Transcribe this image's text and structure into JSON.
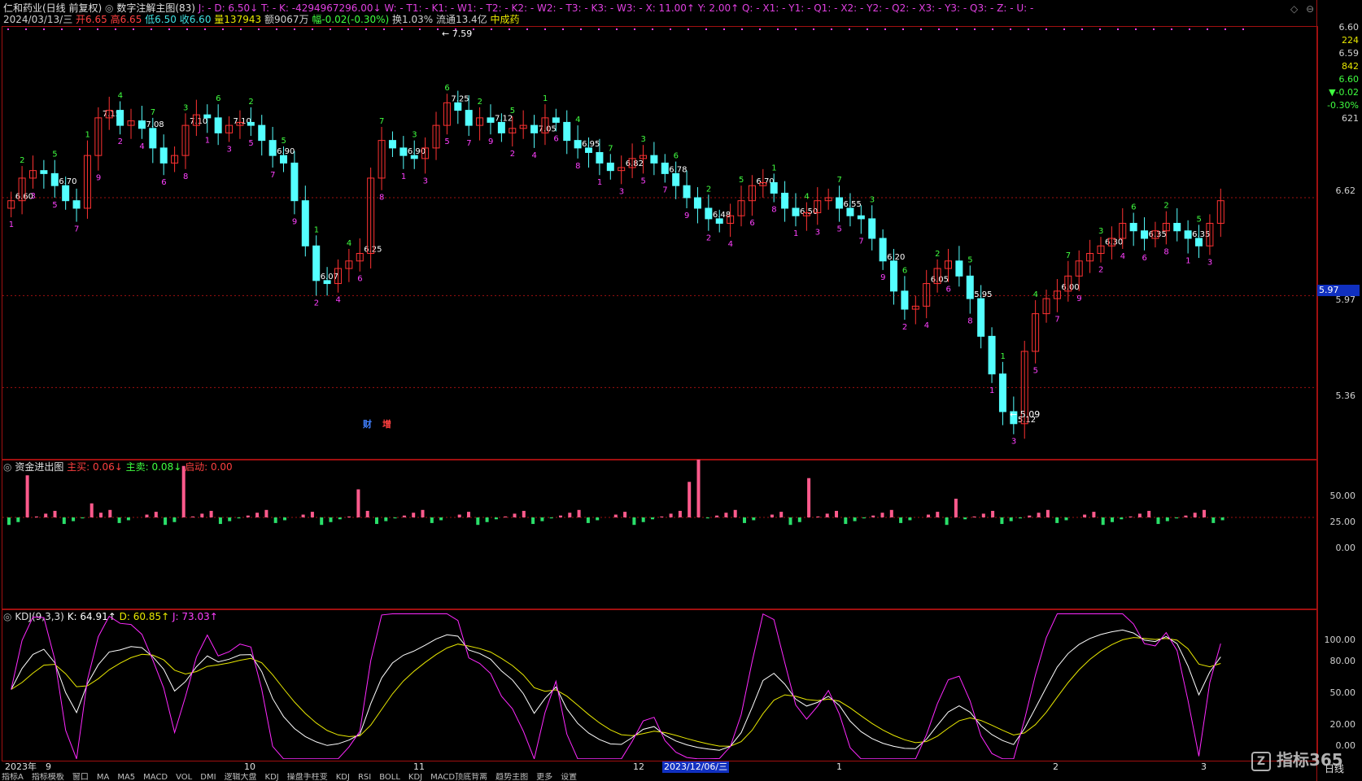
{
  "header": {
    "stock": "仁和药业(日线 前复权)",
    "indicator": "数字注解主图(83)",
    "ind_values": "J: - D: 6.50↓ T: - K: -4294967296.00↓ W: - T1: - K1: - W1: - T2: - K2: - W2: - T3: - K3: - W3: - X: 11.00↑ Y: 2.00↑ Q: - X1: - Y1: - Q1: - X2: - Y2: - Q2: - X3: - Y3: - Q3: - Z: - U: -",
    "date": "2024/03/13/三",
    "open": "开6.65",
    "high": "高6.65",
    "low": "低6.50",
    "close": "收6.60",
    "volume": "量137943",
    "amount": "额9067万",
    "change": "幅-0.02(-0.30%)",
    "turnover": "换1.03%",
    "float": "流通13.4亿",
    "sector": "中成药"
  },
  "right_info": {
    "price1": "6.60",
    "vol1": "224",
    "price2": "6.59",
    "vol2": "842",
    "last": "6.60",
    "chg": "▼-0.02",
    "pct": "-0.30%",
    "amt": "621"
  },
  "price_axis": [
    "6.62",
    "5.97",
    "5.36"
  ],
  "current_price_tag": "5.97",
  "main_marks": [
    "财",
    "增"
  ],
  "max_label": "7.59",
  "min_label": "5.09",
  "fund_panel": {
    "title": "资金进出图",
    "buy_label": "主买: 0.06↓",
    "sell_label": "主卖: 0.08↓",
    "start_label": "启动: 0.00",
    "axis": [
      "50.00",
      "25.00",
      "0.00"
    ]
  },
  "kdj_panel": {
    "title": "KDJ(9,3,3)",
    "k_label": "K: 64.91↑",
    "d_label": "D: 60.85↑",
    "j_label": "J: 73.03↑",
    "axis": [
      "100.00",
      "80.00",
      "50.00",
      "20.00",
      "0.00"
    ]
  },
  "date_axis": {
    "items": [
      "2023年",
      "9",
      "10",
      "11",
      "12",
      "2023/12/06/三",
      "1",
      "2",
      "3"
    ],
    "period": "日线"
  },
  "tabs": [
    "指标A",
    "指标模板",
    "窗口",
    "MA",
    "MA5",
    "MACD",
    "VOL",
    "DMI",
    "逻辑大盘",
    "KDJ",
    "操盘手柱变",
    "KDJ",
    "RSI",
    "BOLL",
    "KDJ",
    "MACD顶底背离",
    "趋势主图",
    "更多",
    "设置"
  ],
  "watermark": "指标365",
  "colors": {
    "up": "#ff3232",
    "down": "#54ffff",
    "border": "#a01010",
    "k": "#ffffff",
    "d": "#e8e800",
    "j": "#ff28ff",
    "buy": "#ff5a8c",
    "sell": "#2adf6a"
  }
}
